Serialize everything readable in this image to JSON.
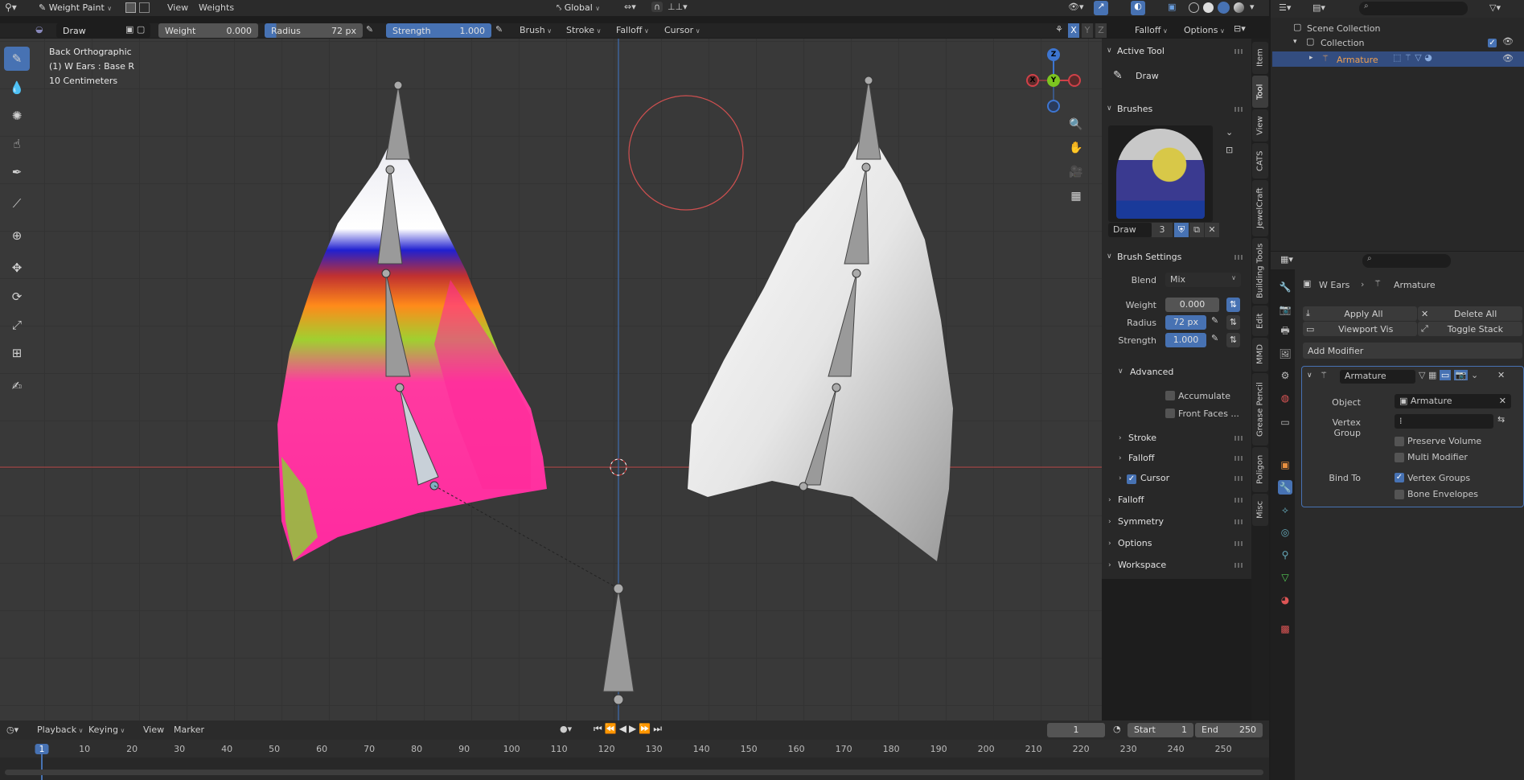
{
  "header": {
    "mode": "Weight Paint",
    "menus": [
      "View",
      "Weights"
    ],
    "orientation": "Global",
    "right_menus": {
      "options": "Options"
    }
  },
  "tool_header": {
    "brush_name": "Draw",
    "weight_label": "Weight",
    "weight_value": "0.000",
    "radius_label": "Radius",
    "radius_value": "72 px",
    "strength_label": "Strength",
    "strength_value": "1.000",
    "menus": [
      "Brush",
      "Stroke",
      "Falloff",
      "Cursor"
    ],
    "falloff_right": "Falloff",
    "xyz": [
      "X",
      "Y",
      "Z"
    ]
  },
  "viewport": {
    "overlay_lines": [
      "Back Orthographic",
      "(1) W Ears : Base R",
      "10 Centimeters"
    ],
    "gizmo": {
      "x": "X",
      "y": "Y",
      "z": "Z"
    }
  },
  "npanel": {
    "active_tool_title": "Active Tool",
    "active_tool_name": "Draw",
    "brushes_title": "Brushes",
    "brush_slot_name": "Draw",
    "brush_users": "3",
    "brush_settings_title": "Brush Settings",
    "blend_label": "Blend",
    "blend_value": "Mix",
    "weight_label": "Weight",
    "weight_value": "0.000",
    "radius_label": "Radius",
    "radius_value": "72 px",
    "strength_label": "Strength",
    "strength_value": "1.000",
    "advanced_title": "Advanced",
    "accumulate": "Accumulate",
    "front_faces": "Front Faces ...",
    "sub_sections": [
      "Stroke",
      "Falloff",
      "Cursor"
    ],
    "sections": [
      "Falloff",
      "Symmetry",
      "Options",
      "Workspace"
    ]
  },
  "vtabs": [
    "Item",
    "Tool",
    "View",
    "CATS",
    "JewelCraft",
    "Building Tools",
    "Edit",
    "MMD",
    "Grease Pencil",
    "Poligon",
    "Misc"
  ],
  "outliner": {
    "scene_collection": "Scene Collection",
    "collection": "Collection",
    "armature": "Armature"
  },
  "properties": {
    "breadcrumb_object": "W Ears",
    "breadcrumb_data": "Armature",
    "apply_all": "Apply All",
    "delete_all": "Delete All",
    "viewport_vis": "Viewport Vis",
    "toggle_stack": "Toggle Stack",
    "add_modifier": "Add Modifier",
    "modifier_name": "Armature",
    "object_label": "Object",
    "object_value": "Armature",
    "vgroup_label": "Vertex Group",
    "vgroup_value": "",
    "preserve_volume": "Preserve Volume",
    "multi_modifier": "Multi Modifier",
    "bind_to_label": "Bind To",
    "vertex_groups": "Vertex Groups",
    "bone_envelopes": "Bone Envelopes"
  },
  "timeline": {
    "menus": [
      "Playback",
      "Keying",
      "View",
      "Marker"
    ],
    "current_frame": "1",
    "start_label": "Start",
    "start_value": "1",
    "end_label": "End",
    "end_value": "250",
    "ticks": [
      "1",
      "10",
      "20",
      "30",
      "40",
      "50",
      "60",
      "70",
      "80",
      "90",
      "100",
      "110",
      "120",
      "130",
      "140",
      "150",
      "160",
      "170",
      "180",
      "190",
      "200",
      "210",
      "220",
      "230",
      "240",
      "250"
    ]
  },
  "colors": {
    "accent": "#4772b3",
    "bg": "#393939",
    "header": "#2b2b2b",
    "armature_text": "#f0a050"
  }
}
